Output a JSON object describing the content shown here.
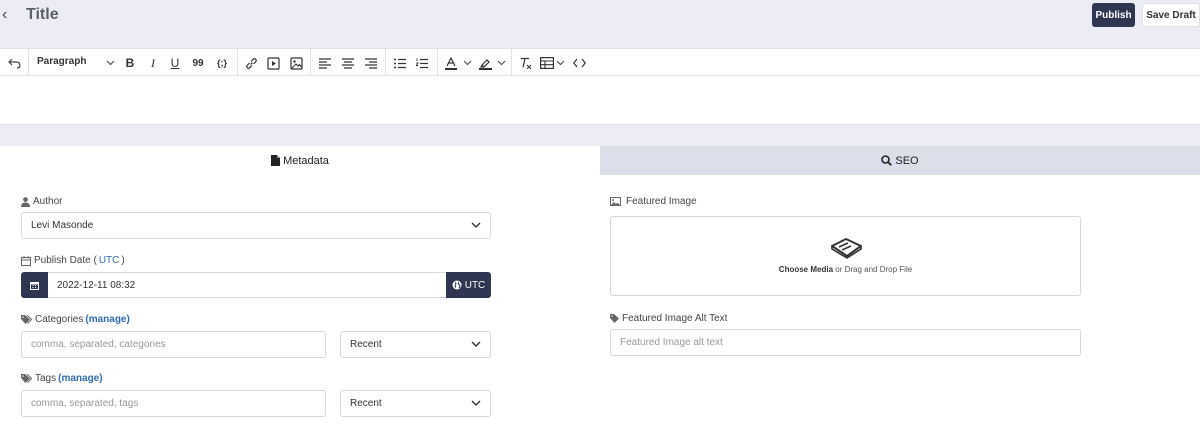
{
  "header": {
    "back_glyph": "‹",
    "title": "Title",
    "publish_label": "Publish",
    "save_draft_label": "Save Draft"
  },
  "toolbar": {
    "block_format": "Paraph",
    "block_format_full": "Paragraph",
    "bold": "B",
    "italic": "I",
    "underline": "U",
    "quote": "99",
    "code_inline": "{;}"
  },
  "tabs": {
    "metadata": "Metadata",
    "seo": "SEO"
  },
  "author": {
    "label": "Author",
    "value": "Levi Masonde"
  },
  "publish_date": {
    "label_prefix": "Publish Date (",
    "label_link": "UTC",
    "label_suffix": ")",
    "value": "2022-12-11 08:32",
    "tz_button": "UTC"
  },
  "categories": {
    "label": "Categories",
    "manage": "(manage)",
    "placeholder": "comma, separated, categories",
    "sort": "Recent"
  },
  "tags": {
    "label": "Tags",
    "manage": "(manage)",
    "placeholder": "comma, separated, tags",
    "sort": "Recent"
  },
  "featured_image": {
    "label": "Featured Image",
    "choose": "Choose Media",
    "or_text": " or Drag and Drop File"
  },
  "alt_text": {
    "label": "Featured Image Alt Text",
    "placeholder": "Featured Image alt text"
  },
  "colors": {
    "primary_dark": "#2f3651",
    "link": "#2f6db0",
    "topbar_bg": "#ecedf4",
    "inactive_tab_bg": "#dcdfea"
  }
}
